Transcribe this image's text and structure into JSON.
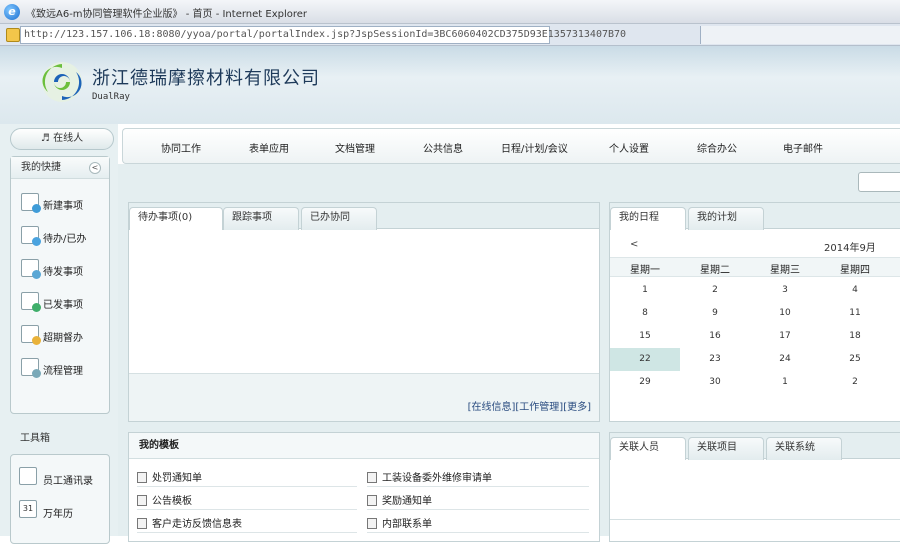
{
  "browser": {
    "window_title": "《致远A6-m协同管理软件企业版》 - 首页   - Internet Explorer",
    "url": "http://123.157.106.18:8080/yyoa/portal/portalIndex.jsp?JspSessionId=3BC6060402CD375D93E1357313407B70"
  },
  "header": {
    "company_name": "浙江德瑞摩擦材料有限公司",
    "company_name_en": "DualRay"
  },
  "sidebar": {
    "online_label": "在线人",
    "shortcuts_title": "我的快捷",
    "collapse": "<",
    "shortcuts": [
      {
        "label": "新建事项",
        "icon": "new-item-icon"
      },
      {
        "label": "待办/已办",
        "icon": "todo-done-icon"
      },
      {
        "label": "待发事项",
        "icon": "pending-send-icon"
      },
      {
        "label": "已发事项",
        "icon": "sent-icon"
      },
      {
        "label": "超期督办",
        "icon": "overdue-icon"
      },
      {
        "label": "流程管理",
        "icon": "workflow-icon"
      }
    ],
    "tools_title": "工具箱",
    "tools": [
      {
        "label": "员工通讯录",
        "icon": "address-book-icon"
      },
      {
        "label": "万年历",
        "icon": "calendar-icon",
        "badge": "31"
      }
    ]
  },
  "nav": {
    "items": [
      "协同工作",
      "表单应用",
      "文档管理",
      "公共信息",
      "日程/计划/会议",
      "个人设置",
      "综合办公",
      "电子邮件"
    ]
  },
  "pending_panel": {
    "tabs": [
      "待办事项(0)",
      "跟踪事项",
      "已办协同"
    ],
    "links": [
      "[在线信息]",
      "[工作管理]",
      "[更多]"
    ]
  },
  "calendar_panel": {
    "tabs": [
      "我的日程",
      "我的计划"
    ],
    "prev": "<",
    "month": "2014年9月",
    "weekdays": [
      "星期一",
      "星期二",
      "星期三",
      "星期四"
    ],
    "rows": [
      [
        "1",
        "2",
        "3",
        "4"
      ],
      [
        "8",
        "9",
        "10",
        "11"
      ],
      [
        "15",
        "16",
        "17",
        "18"
      ],
      [
        "22",
        "23",
        "24",
        "25"
      ],
      [
        "29",
        "30",
        "1",
        "2"
      ]
    ],
    "today": "22"
  },
  "templates_panel": {
    "title": "我的模板",
    "left_items": [
      "处罚通知单",
      "公告模板",
      "客户走访反馈信息表"
    ],
    "right_items": [
      "工装设备委外维修审请单",
      "奖励通知单",
      "内部联系单"
    ]
  },
  "related_panel": {
    "tabs": [
      "关联人员",
      "关联项目",
      "关联系统"
    ]
  },
  "colors": {
    "accent": "#2a4c80",
    "today_highlight": "#cfe6e4",
    "frame_bg": "#e4eef0"
  }
}
